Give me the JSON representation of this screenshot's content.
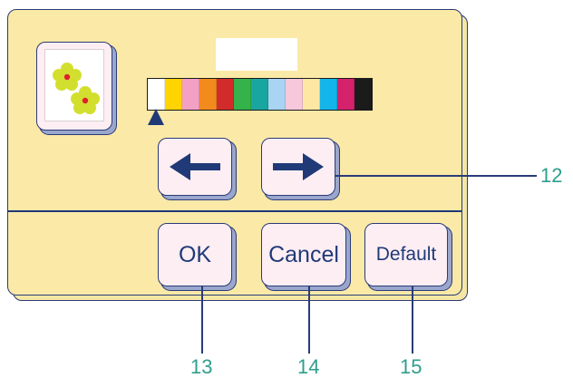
{
  "preview": {
    "icon": "flower-pattern-icon"
  },
  "name_field": {
    "value": ""
  },
  "palette": {
    "colors": [
      "#ffffff",
      "#ffd400",
      "#f4a0c4",
      "#f28a1e",
      "#d22b2b",
      "#34b34a",
      "#1aa6a0",
      "#a9d4f4",
      "#f7c7dc",
      "#fde7a2",
      "#13b5ea",
      "#d6216c",
      "#1b1b1b"
    ],
    "selected_index": 0,
    "selector_icon": "triangle-up-icon"
  },
  "navigation": {
    "left_icon": "arrow-left-icon",
    "right_icon": "arrow-right-icon"
  },
  "actions": {
    "ok_label": "OK",
    "cancel_label": "Cancel",
    "default_label": "Default"
  },
  "callouts": {
    "arrows": "12",
    "ok": "13",
    "cancel": "14",
    "default": "15"
  },
  "colors": {
    "panel": "#fbe9a7",
    "outline": "#2a3b78",
    "button_fill": "#fdeef3",
    "label_text": "#203a78",
    "callout_text": "#2e9e8c"
  }
}
